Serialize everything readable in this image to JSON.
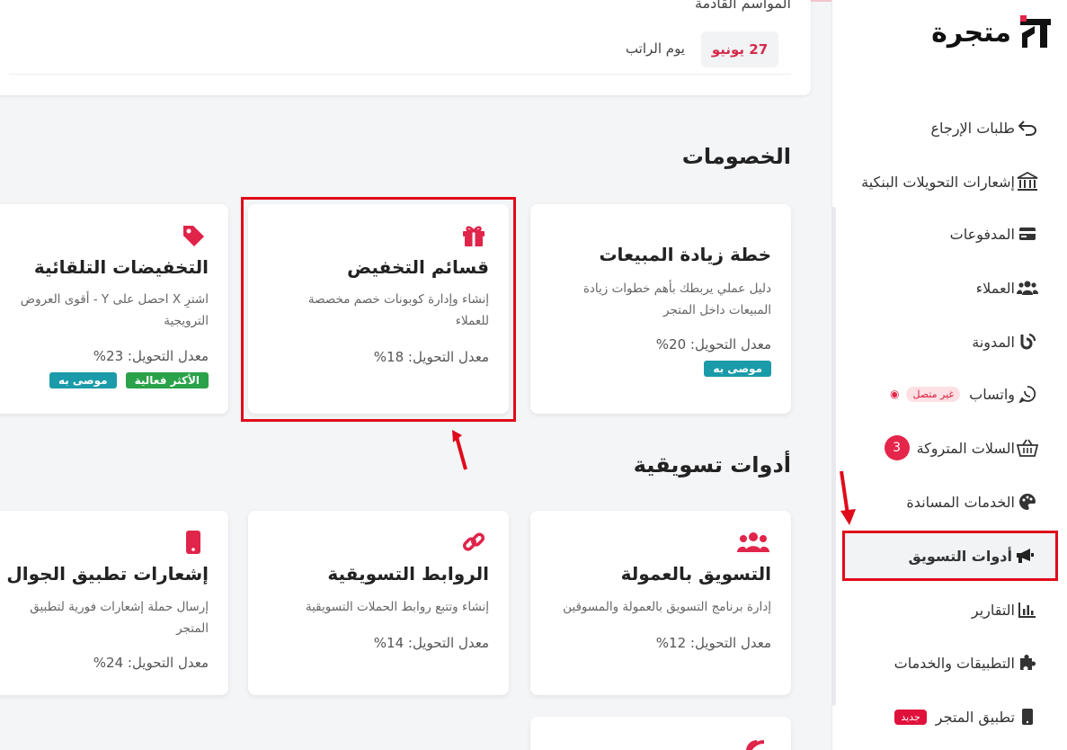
{
  "brand": {
    "name": "متجرة"
  },
  "events": {
    "title": "المواسم القادمة",
    "items": [
      {
        "date": "27 يونيو",
        "name": "يوم الراتب"
      }
    ]
  },
  "sidebar": {
    "items": [
      {
        "label": "طلبات الإرجاع",
        "icon": "return-arrow-icon"
      },
      {
        "label": "إشعارات التحويلات البنكية",
        "icon": "bank-icon"
      },
      {
        "label": "المدفوعات",
        "icon": "credit-card-icon"
      },
      {
        "label": "العملاء",
        "icon": "users-icon"
      },
      {
        "label": "المدونة",
        "icon": "blog-icon"
      },
      {
        "label": "واتساب",
        "icon": "whatsapp-icon",
        "badge": "غير متصل"
      },
      {
        "label": "السلات المتروكة",
        "icon": "basket-icon",
        "count": "3"
      },
      {
        "label": "الخدمات المساندة",
        "icon": "palette-icon"
      },
      {
        "label": "أدوات التسويق",
        "icon": "megaphone-icon",
        "active": true
      },
      {
        "label": "التقارير",
        "icon": "chart-icon"
      },
      {
        "label": "التطبيقات والخدمات",
        "icon": "puzzle-icon"
      },
      {
        "label": "تطبيق المتجر",
        "icon": "mobile-icon",
        "badge": "جديد"
      }
    ]
  },
  "discounts": {
    "title": "الخصومات",
    "cards": [
      {
        "title": "خطة زيادة المبيعات",
        "desc": "دليل عملي يربطك بأهم خطوات زيادة المبيعات داخل المتجر",
        "rate": "معدل التحويل: 20%",
        "tags": [
          "موصى به"
        ]
      },
      {
        "title": "قسائم التخفيض",
        "desc": "إنشاء وإدارة كوبونات خصم مخصصة للعملاء",
        "rate": "معدل التحويل: 18%",
        "icon": "gift-icon"
      },
      {
        "title": "التخفيضات التلقائية",
        "desc": "اشترِ X احصل على Y - أقوى العروض الترويجية",
        "rate": "معدل التحويل: 23%",
        "icon": "tag-icon",
        "tags": [
          "الأكثر فعالية",
          "موصى به"
        ]
      }
    ]
  },
  "marketing": {
    "title": "أدوات تسويقية",
    "cards": [
      {
        "title": "التسويق بالعمولة",
        "desc": "إدارة برنامج التسويق بالعمولة والمسوقين",
        "rate": "معدل التحويل: 12%",
        "icon": "users-icon"
      },
      {
        "title": "الروابط التسويقية",
        "desc": "إنشاء وتتبع روابط الحملات التسويقية",
        "rate": "معدل التحويل: 14%",
        "icon": "link-icon"
      },
      {
        "title": "إشعارات تطبيق الجوال",
        "desc": "إرسال حملة إشعارات فورية لتطبيق المتجر",
        "rate": "معدل التحويل: 24%",
        "icon": "mobile-icon"
      }
    ]
  },
  "colors": {
    "accent": "#e0244a",
    "highlight": "#e00b1a",
    "teal": "#1b9ba9",
    "green": "#2aa24a"
  }
}
